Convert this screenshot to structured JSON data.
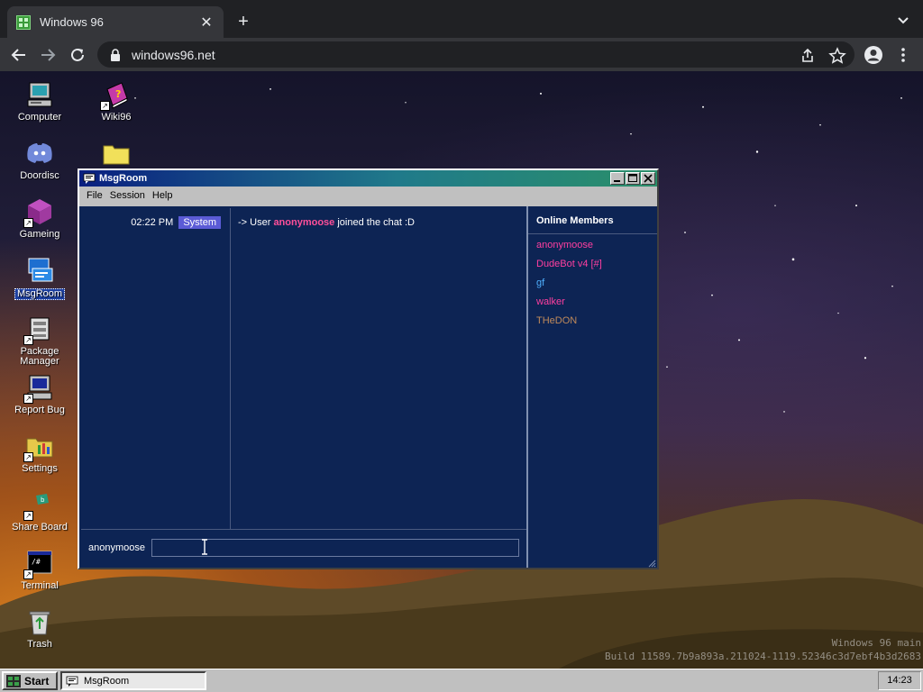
{
  "browser": {
    "tab_title": "Windows 96",
    "url": "windows96.net",
    "close_glyph": "✕",
    "newtab_glyph": "+"
  },
  "desktop": {
    "icons": [
      {
        "label": "Computer"
      },
      {
        "label": "Wiki96"
      },
      {
        "label": "Doordisc"
      },
      {
        "label": "Gameing"
      },
      {
        "label": "MsgRoom"
      },
      {
        "label": "Package Manager"
      },
      {
        "label": "Report Bug"
      },
      {
        "label": "Settings"
      },
      {
        "label": "Share Board"
      },
      {
        "label": "Terminal"
      },
      {
        "label": "Trash"
      }
    ],
    "build_line1": "Windows 96 main",
    "build_line2": "Build 11589.7b9a893a.211024-1119.52346c3d7ebf4b3d2683"
  },
  "window": {
    "title": "MsgRoom",
    "menu": [
      "File",
      "Session",
      "Help"
    ],
    "messages": [
      {
        "time": "02:22 PM",
        "tag": "System",
        "prefix": "-> User ",
        "user": "anonymoose",
        "suffix": " joined the chat :D"
      }
    ],
    "members_title": "Online Members",
    "members": [
      {
        "name": "anonymoose",
        "color": "#ff3fa0"
      },
      {
        "name": "DudeBot v4 [#]",
        "color": "#ff3fa0"
      },
      {
        "name": "gf",
        "color": "#4fb0ff"
      },
      {
        "name": "walker",
        "color": "#ff3fa0"
      },
      {
        "name": "THeDON",
        "color": "#c08a5a"
      }
    ],
    "nick": "anonymoose",
    "input_value": "",
    "input_placeholder": ""
  },
  "taskbar": {
    "start_label": "Start",
    "task_label": "MsgRoom",
    "clock": "14:23"
  },
  "colors": {
    "chat_bg": "#0d2454",
    "accent": "#5b5bd6"
  }
}
